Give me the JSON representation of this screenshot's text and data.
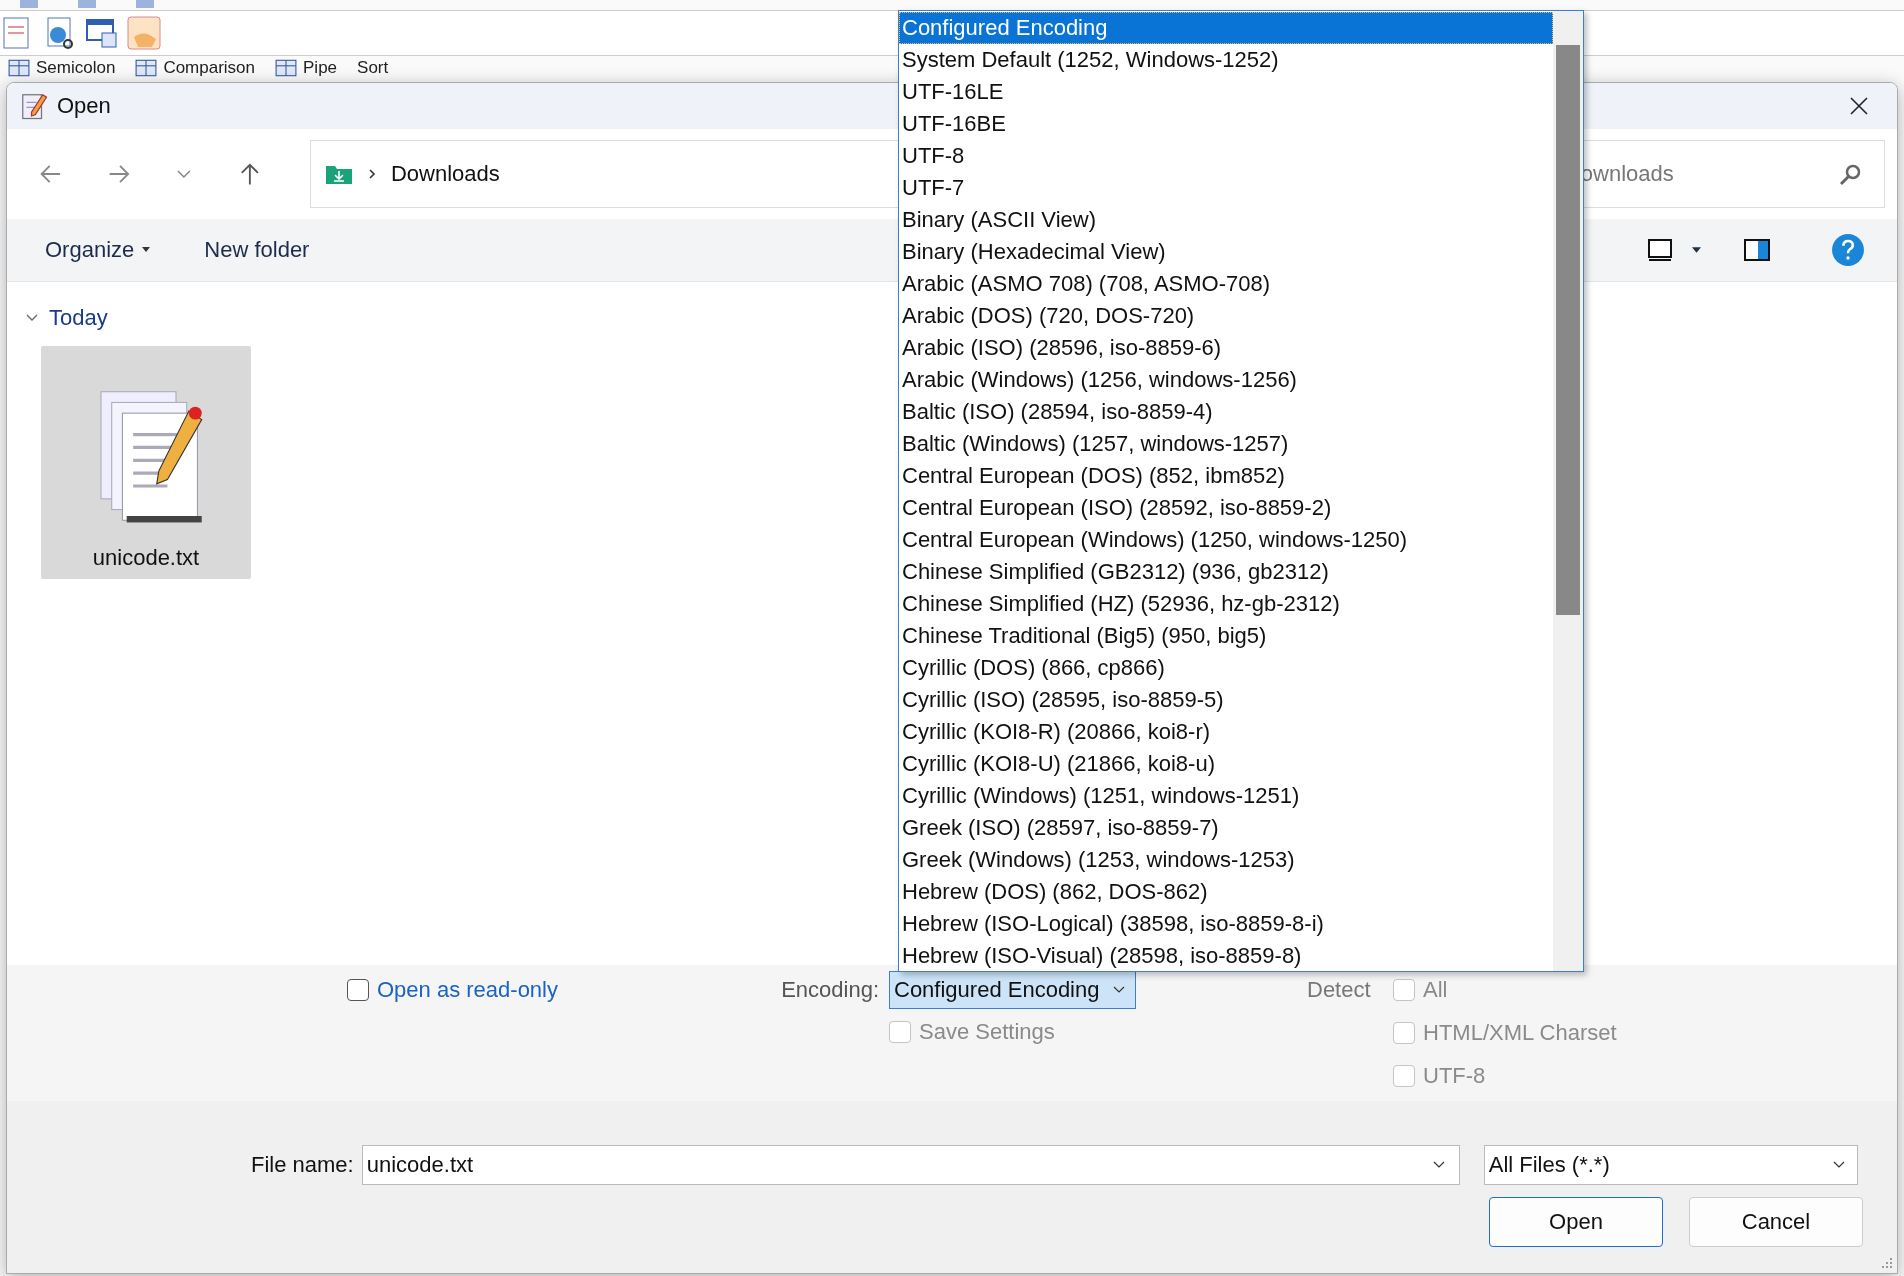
{
  "app": {
    "toolbar_labels": [
      "Semicolon",
      "Comparison",
      "Pipe",
      "Sort"
    ]
  },
  "dialog": {
    "title": "Open"
  },
  "nav": {
    "path": [
      "Downloads"
    ],
    "search": {
      "placeholder": "ownloads"
    }
  },
  "commands": {
    "organize": "Organize",
    "new_folder": "New folder"
  },
  "groups": [
    {
      "label": "Today",
      "expanded": true,
      "files": [
        {
          "name": "unicode.txt",
          "selected": true
        }
      ]
    }
  ],
  "options": {
    "read_only": {
      "label": "Open as read-only",
      "checked": false,
      "disabled": false
    },
    "encoding_label": "Encoding:",
    "encoding_value": "Configured Encoding",
    "save_settings": {
      "label": "Save Settings",
      "checked": false,
      "disabled": true
    },
    "detect_label": "Detect",
    "detect": [
      {
        "label": "All",
        "checked": false,
        "disabled": true
      },
      {
        "label": "HTML/XML Charset",
        "checked": false,
        "disabled": true
      },
      {
        "label": "UTF-8",
        "checked": false,
        "disabled": true
      }
    ]
  },
  "encoding_list": {
    "items": [
      {
        "label": "Configured Encoding",
        "selected": true
      },
      {
        "label": "System Default (1252, Windows-1252)",
        "selected": false
      },
      {
        "label": "UTF-16LE",
        "selected": false
      },
      {
        "label": "UTF-16BE",
        "selected": false
      },
      {
        "label": "UTF-8",
        "selected": false
      },
      {
        "label": "UTF-7",
        "selected": false
      },
      {
        "label": "Binary (ASCII View)",
        "selected": false
      },
      {
        "label": "Binary (Hexadecimal View)",
        "selected": false
      },
      {
        "label": "Arabic (ASMO 708) (708, ASMO-708)",
        "selected": false
      },
      {
        "label": "Arabic (DOS) (720, DOS-720)",
        "selected": false
      },
      {
        "label": "Arabic (ISO) (28596, iso-8859-6)",
        "selected": false
      },
      {
        "label": "Arabic (Windows) (1256, windows-1256)",
        "selected": false
      },
      {
        "label": "Baltic (ISO) (28594, iso-8859-4)",
        "selected": false
      },
      {
        "label": "Baltic (Windows) (1257, windows-1257)",
        "selected": false
      },
      {
        "label": "Central European (DOS) (852, ibm852)",
        "selected": false
      },
      {
        "label": "Central European (ISO) (28592, iso-8859-2)",
        "selected": false
      },
      {
        "label": "Central European (Windows) (1250, windows-1250)",
        "selected": false
      },
      {
        "label": "Chinese Simplified (GB2312) (936, gb2312)",
        "selected": false
      },
      {
        "label": "Chinese Simplified (HZ) (52936, hz-gb-2312)",
        "selected": false
      },
      {
        "label": "Chinese Traditional (Big5) (950, big5)",
        "selected": false
      },
      {
        "label": "Cyrillic (DOS) (866, cp866)",
        "selected": false
      },
      {
        "label": "Cyrillic (ISO) (28595, iso-8859-5)",
        "selected": false
      },
      {
        "label": "Cyrillic (KOI8-R) (20866, koi8-r)",
        "selected": false
      },
      {
        "label": "Cyrillic (KOI8-U) (21866, koi8-u)",
        "selected": false
      },
      {
        "label": "Cyrillic (Windows) (1251, windows-1251)",
        "selected": false
      },
      {
        "label": "Greek (ISO) (28597, iso-8859-7)",
        "selected": false
      },
      {
        "label": "Greek (Windows) (1253, windows-1253)",
        "selected": false
      },
      {
        "label": "Hebrew (DOS) (862, DOS-862)",
        "selected": false
      },
      {
        "label": "Hebrew (ISO-Logical) (38598, iso-8859-8-i)",
        "selected": false
      },
      {
        "label": "Hebrew (ISO-Visual) (28598, iso-8859-8)",
        "selected": false
      }
    ]
  },
  "footer": {
    "file_name_label": "File name:",
    "file_name": "unicode.txt",
    "filter": "All Files (*.*)",
    "buttons": [
      {
        "label": "Open",
        "default": true
      },
      {
        "label": "Cancel",
        "default": false
      }
    ]
  }
}
